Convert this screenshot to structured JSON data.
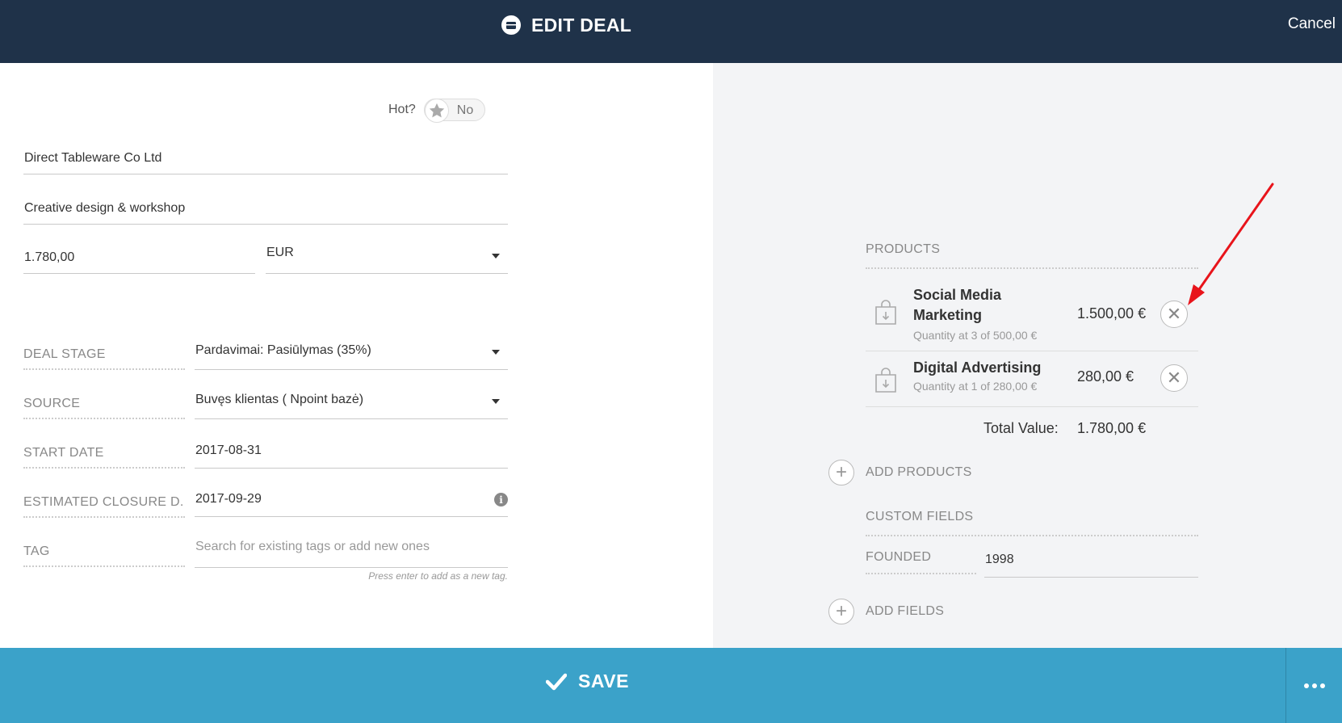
{
  "header": {
    "title": "EDIT DEAL",
    "cancel_label": "Cancel",
    "icon": "deal-icon"
  },
  "form": {
    "hot": {
      "label": "Hot?",
      "value": "No"
    },
    "organization": "Direct Tableware Co Ltd",
    "deal_name": "Creative design & workshop",
    "amount": "1.780,00",
    "currency": "EUR",
    "rows": [
      {
        "label": "DEAL STAGE",
        "value": "Pardavimai: Pasiūlymas (35%)"
      },
      {
        "label": "SOURCE",
        "value": "Buvęs klientas ( Npoint bazė)"
      },
      {
        "label": "START DATE",
        "value": "2017-08-31"
      },
      {
        "label": "ESTIMATED CLOSURE D...",
        "value": "2017-09-29"
      },
      {
        "label": "TAG",
        "placeholder": "Search for existing tags or add new ones"
      }
    ],
    "tag_hint": "Press enter to add as a new tag."
  },
  "products": {
    "title": "PRODUCTS",
    "items": [
      {
        "name": "Social Media Marketing",
        "name_line1": "Social Media",
        "name_line2": "Marketing",
        "qty": "Quantity at 3 of 500,00 €",
        "price": "1.500,00 €"
      },
      {
        "name": "Digital Advertising",
        "qty": "Quantity at 1 of 280,00 €",
        "price": "280,00 €"
      }
    ],
    "total_label": "Total Value:",
    "total_value": "1.780,00 €",
    "add_label": "ADD PRODUCTS"
  },
  "custom_fields": {
    "title": "CUSTOM FIELDS",
    "fields": [
      {
        "label": "FOUNDED",
        "value": "1998"
      }
    ],
    "add_label": "ADD FIELDS"
  },
  "footer": {
    "save_label": "SAVE"
  },
  "colors": {
    "header_bg": "#1f3249",
    "footer_bg": "#3ba2c9",
    "annotation_arrow": "#e8141b"
  }
}
